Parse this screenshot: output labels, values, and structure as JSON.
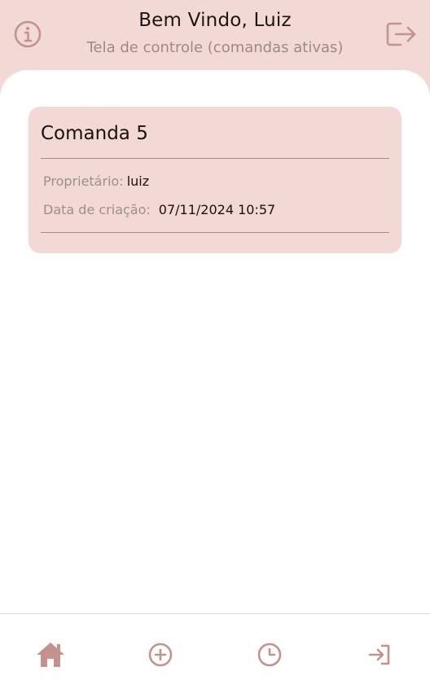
{
  "header": {
    "title": "Bem Vindo, Luiz",
    "subtitle": "Tela de controle (comandas ativas)",
    "info_icon": "info-circle-icon",
    "logout_icon": "logout-icon"
  },
  "comandas": [
    {
      "title": "Comanda 5",
      "owner_label": "Proprietário:",
      "owner": "luiz",
      "created_label": "Data de criação:",
      "created": "07/11/2024 10:57"
    }
  ],
  "nav": {
    "items": [
      {
        "icon": "home-icon",
        "active": true
      },
      {
        "icon": "plus-circle-icon",
        "active": false
      },
      {
        "icon": "clock-icon",
        "active": false
      },
      {
        "icon": "login-icon",
        "active": false
      }
    ]
  },
  "colors": {
    "accent": "#c4928d",
    "header_bg": "#f3d9d6",
    "card_bg": "#f3d9d6",
    "muted_text": "#9a8f8d"
  }
}
